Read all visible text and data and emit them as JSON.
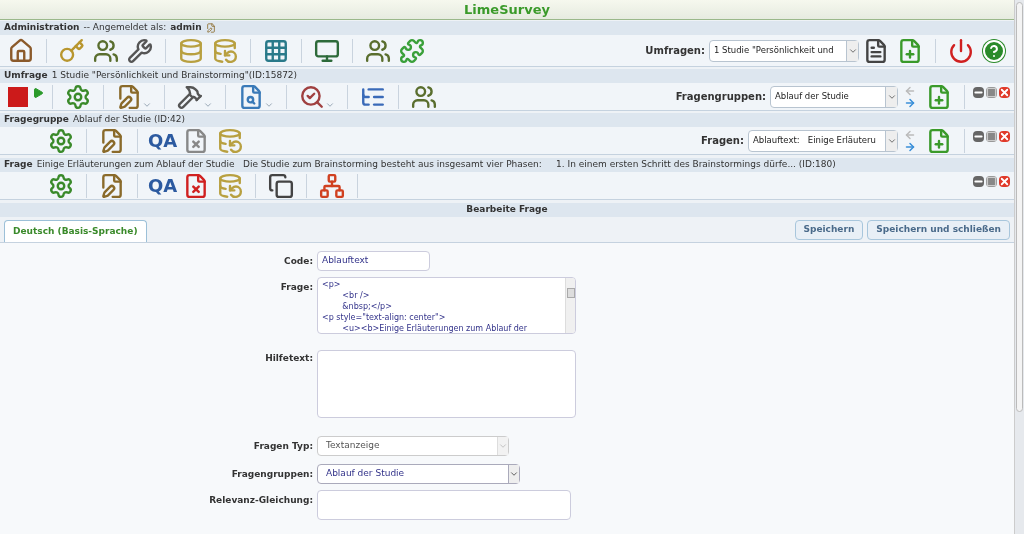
{
  "app_title": "LimeSurvey",
  "admin": {
    "label": "Administration",
    "login_text": "-- Angemeldet als:",
    "user": "admin",
    "survey_select_label": "Umfragen:",
    "survey_select_value": "1 Studie \"Persönlichkeit und"
  },
  "survey": {
    "label": "Umfrage",
    "text": "1 Studie \"Persönlichkeit und Brainstorming\"(ID:15872)",
    "group_select_label": "Fragengruppen:",
    "group_select_value": "Ablauf der Studie"
  },
  "group": {
    "label": "Fragegruppe",
    "text": "Ablauf der Studie (ID:42)",
    "qa_icon_text": "QA",
    "question_select_label": "Fragen:",
    "question_select_value": "Ablauftext:   Einige Erläuteru"
  },
  "question": {
    "label": "Frage",
    "text": "Einige Erläuterungen zum Ablauf der Studie   Die Studie zum Brainstorming besteht aus insgesamt vier Phasen:     1. In einem ersten Schritt des Brainstormings dürfe... (ID:180)",
    "qa_icon_text": "QA"
  },
  "section_title": "Bearbeite Frage",
  "tabs": [
    {
      "label": "Deutsch (Basis-Sprache)",
      "selected": true
    }
  ],
  "buttons": [
    "Speichern",
    "Speichern und schließen"
  ],
  "form": [
    {
      "kind": "input",
      "label": "Code:",
      "value": "Ablauftext"
    },
    {
      "kind": "code",
      "label": "Frage:",
      "lines": [
        "<p>",
        "        <br />",
        "        &nbsp;</p>",
        "<p style=\"text-align: center\">",
        "        <u><b>Einige Erläuterungen zum Ablauf der"
      ]
    },
    {
      "kind": "textarea",
      "label": "Hilfetext:"
    },
    {
      "kind": "select",
      "label": "Fragen Typ:",
      "value": "Textanzeige",
      "disabled": true
    },
    {
      "kind": "select",
      "label": "Fragengruppen:",
      "value": "Ablauf der Studie",
      "disabled": false
    },
    {
      "kind": "smalltext",
      "label": "Relevanz-Gleichung:"
    }
  ]
}
